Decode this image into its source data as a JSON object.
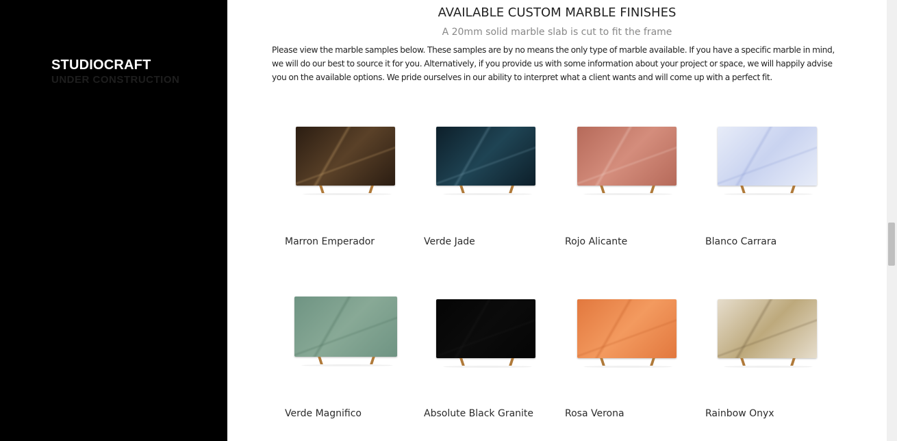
{
  "sidebar": {
    "brand": "STUDIOCRAFT",
    "tagline": "UNDER CONSTRUCTION"
  },
  "main": {
    "title": "AVAILABLE CUSTOM MARBLE FINISHES",
    "subtitle": "A 20mm solid marble slab is cut to fit the frame",
    "intro": "Please view the marble samples below. These samples are by no means the only type of marble available. If you have a specific marble in mind, we will do our best to source it for you. Alternatively, if you provide us with some information about your project or space, we will happily advise you on the available options. We pride ourselves in our ability to interpret what a client wants and will come up with a perfect fit."
  },
  "slabs": [
    {
      "name": "Marron Emperador",
      "colors": [
        "#2b1d12",
        "#5a4128",
        "#c9a26b"
      ]
    },
    {
      "name": "Verde Jade",
      "colors": [
        "#0d1f2a",
        "#1f4454",
        "#6f97a8"
      ]
    },
    {
      "name": "Rojo Alicante",
      "colors": [
        "#b66a5a",
        "#d48d7c",
        "#f0cfc4"
      ]
    },
    {
      "name": "Blanco Carrara",
      "colors": [
        "#e7ecf8",
        "#c9d3f0",
        "#8f9fd6"
      ]
    },
    {
      "name": "Verde Magnifico",
      "colors": [
        "#6f9483",
        "#88a996",
        "#4b6f5c"
      ]
    },
    {
      "name": "Absolute Black Granite",
      "colors": [
        "#050505",
        "#0b0b0b",
        "#1a1a1a"
      ]
    },
    {
      "name": "Rosa Verona",
      "colors": [
        "#e2783e",
        "#f39a5f",
        "#c45d26"
      ]
    },
    {
      "name": "Rainbow Onyx",
      "colors": [
        "#e6ddcc",
        "#bda97c",
        "#6d5a3a"
      ]
    }
  ]
}
